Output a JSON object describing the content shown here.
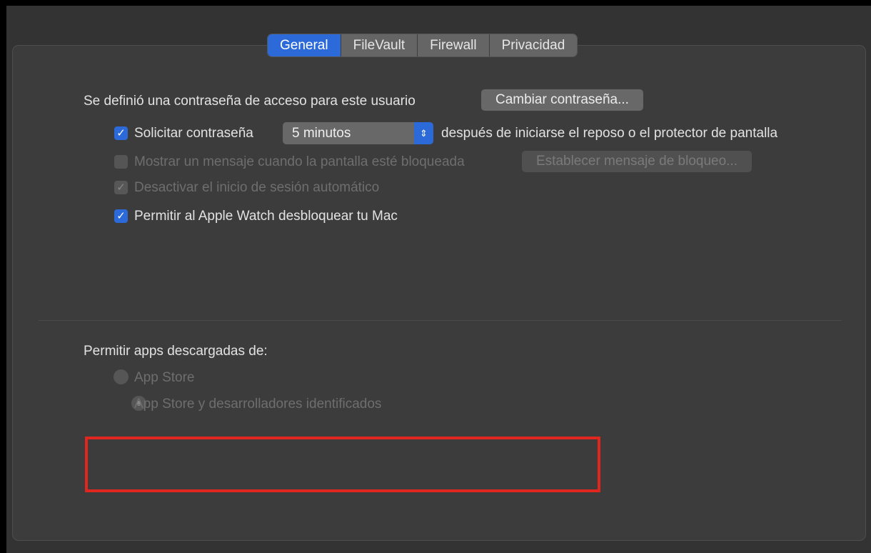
{
  "tabs": [
    {
      "label": "General",
      "active": true
    },
    {
      "label": "FileVault",
      "active": false
    },
    {
      "label": "Firewall",
      "active": false
    },
    {
      "label": "Privacidad",
      "active": false
    }
  ],
  "general": {
    "password_set_text": "Se definió una contraseña de acceso para este usuario",
    "change_password_button": "Cambiar contraseña...",
    "require_password": {
      "label": "Solicitar contraseña",
      "checked": true,
      "select_value": "5 minutos",
      "suffix": "después de iniciarse el reposo o el protector de pantalla"
    },
    "show_message": {
      "label": "Mostrar un mensaje cuando la pantalla esté bloqueada",
      "checked": false,
      "enabled": false,
      "button": "Establecer mensaje de bloqueo..."
    },
    "disable_autologin": {
      "label": "Desactivar el inicio de sesión automático",
      "checked": true,
      "enabled": false
    },
    "apple_watch": {
      "label": "Permitir al Apple Watch desbloquear tu Mac",
      "checked": true
    }
  },
  "downloads": {
    "heading": "Permitir apps descargadas de:",
    "options": [
      {
        "label": "App Store",
        "selected": false
      },
      {
        "label": "App Store y desarrolladores identificados",
        "selected": true
      }
    ]
  },
  "colors": {
    "accent": "#2b6ad8",
    "highlight": "#e12620"
  }
}
